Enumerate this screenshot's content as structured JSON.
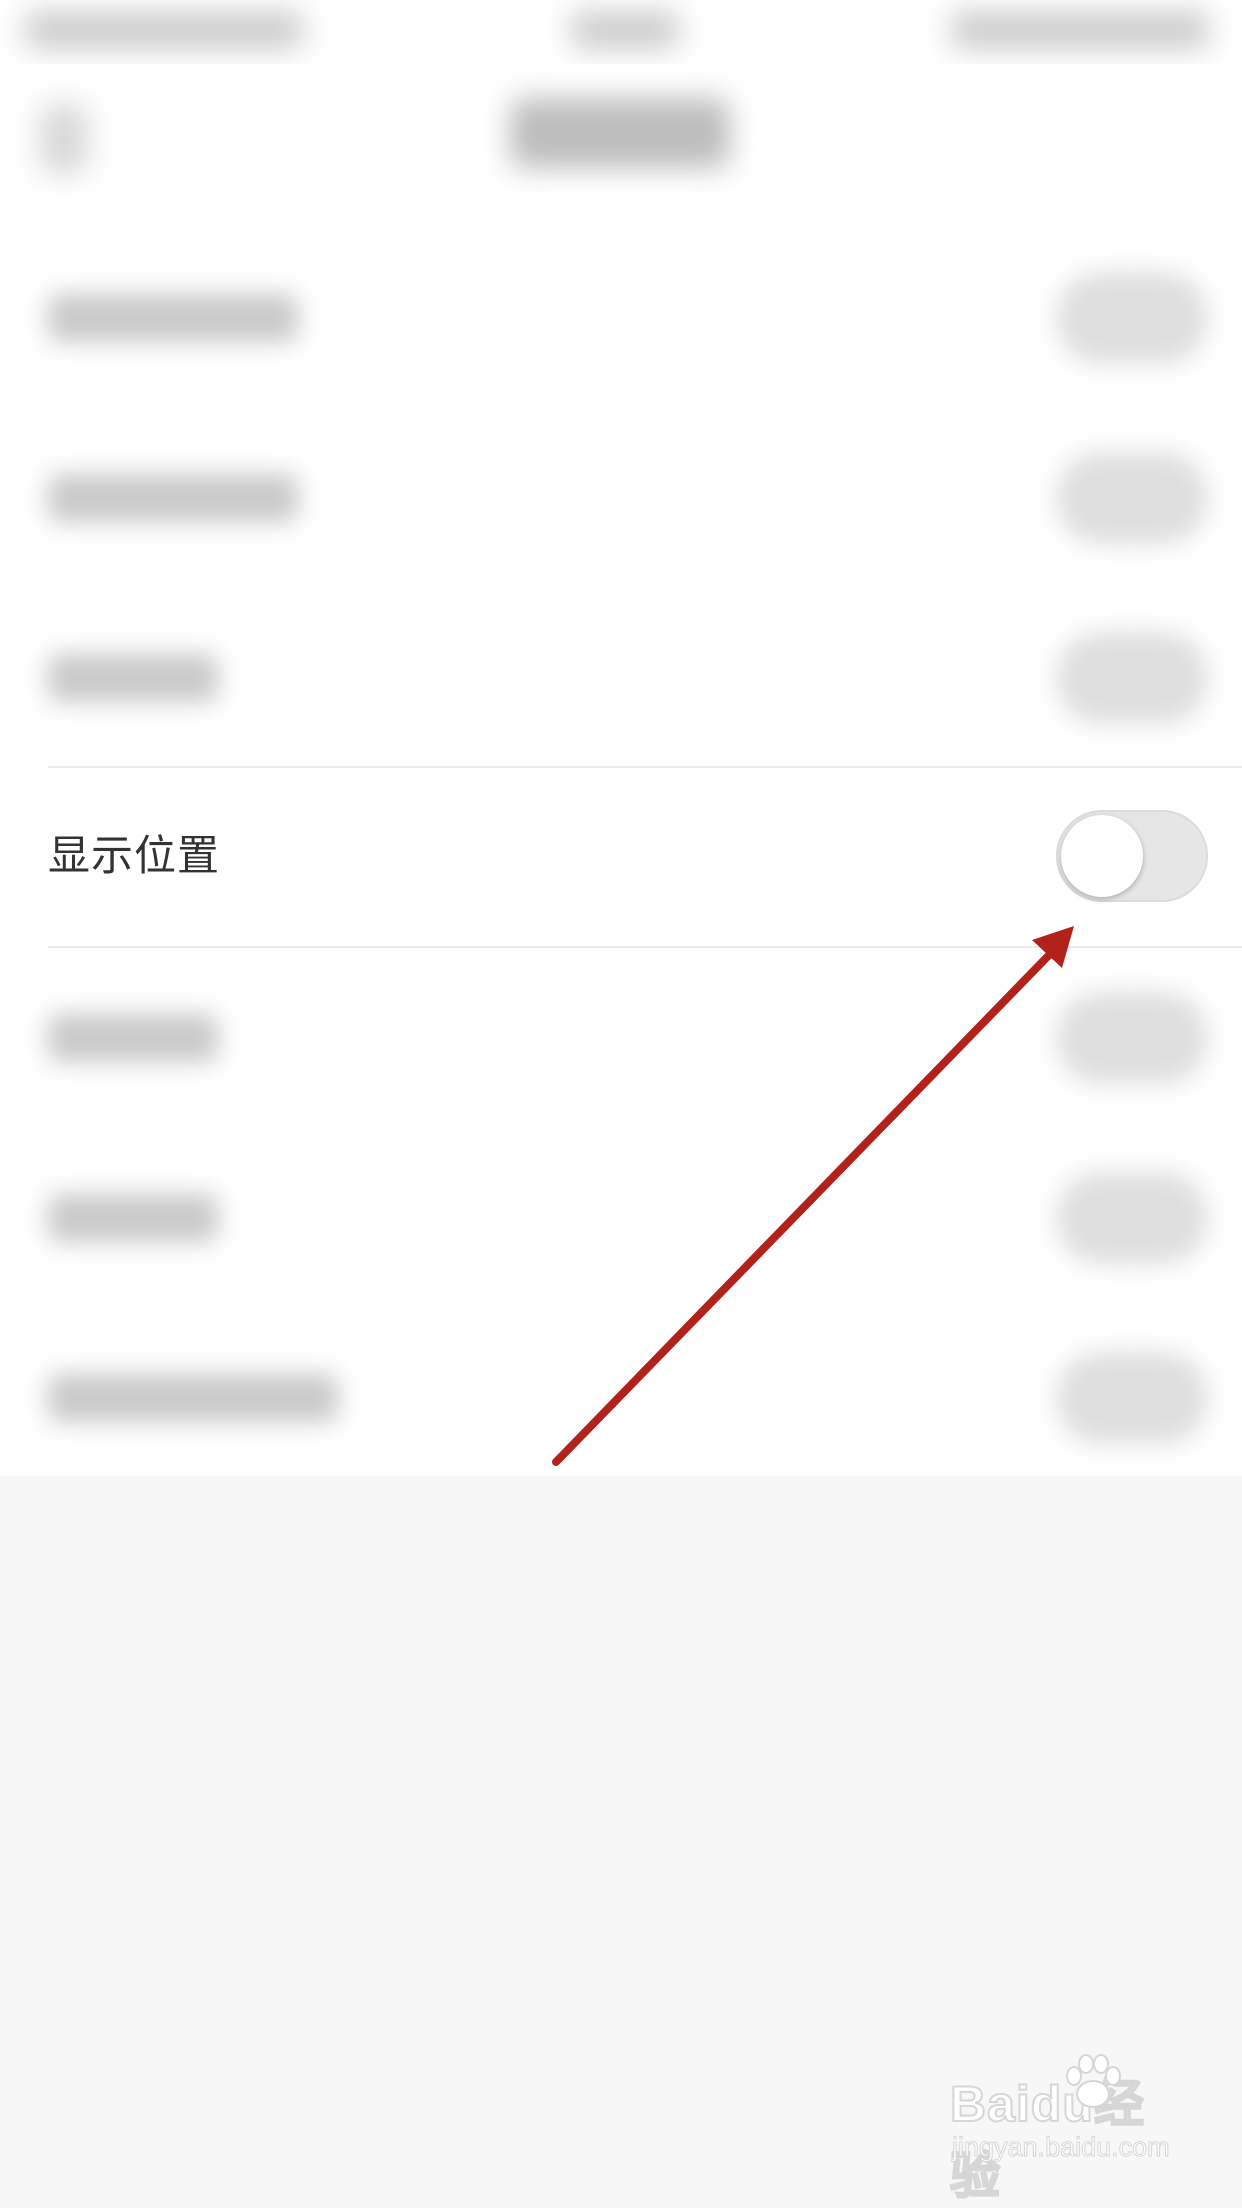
{
  "settings": {
    "show_location": {
      "label": "显示位置",
      "enabled": false
    }
  },
  "annotation": {
    "arrow_color": "#b3221a",
    "arrow_icon": "red-arrow-annotation"
  },
  "colors": {
    "toggle_off_track": "#e6e6e6",
    "toggle_knob": "#ffffff",
    "page_background": "#f7f7f7",
    "list_background": "#ffffff"
  },
  "watermark": {
    "brand": "Baidu经验",
    "url": "jingyan.baidu.com"
  }
}
